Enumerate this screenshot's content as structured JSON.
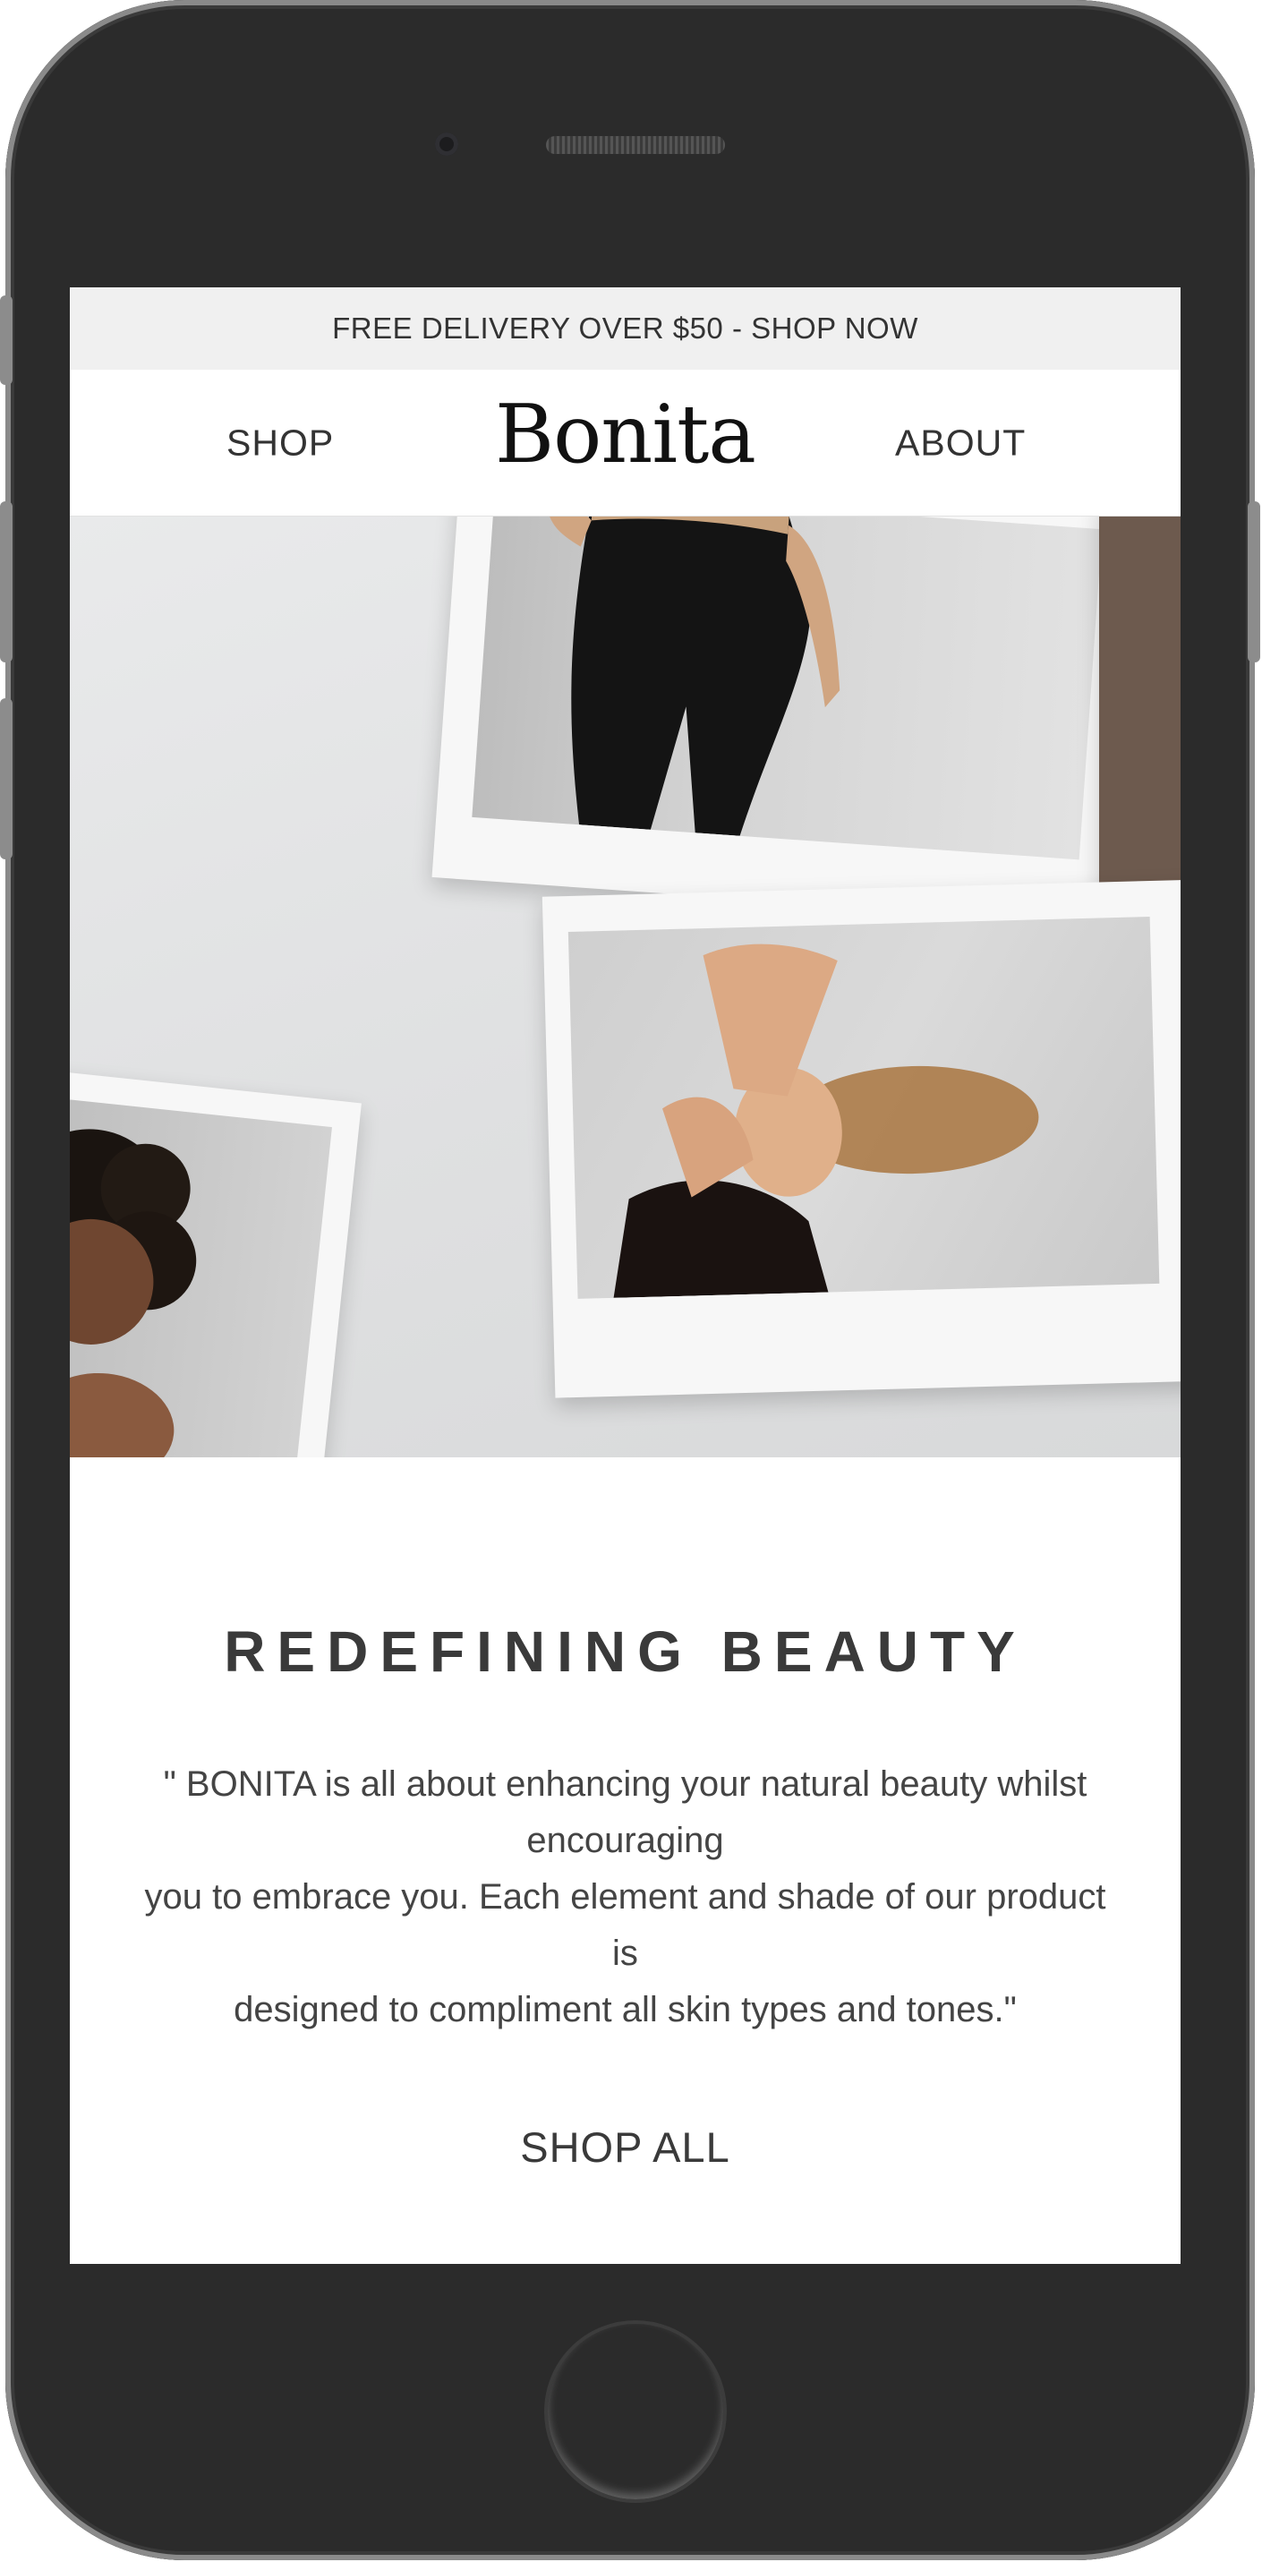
{
  "promo": {
    "text": "FREE DELIVERY OVER $50 - SHOP NOW"
  },
  "nav": {
    "shop_label": "SHOP",
    "brand": "Bonita",
    "about_label": "ABOUT"
  },
  "hero": {
    "image_description_icons": [
      "photo-tights-back",
      "photo-woman-lying",
      "photo-curly-hair"
    ]
  },
  "main": {
    "headline": "REDEFINING BEAUTY",
    "quote_line1": "\" BONITA is all about enhancing your natural beauty whilst encouraging",
    "quote_line2": "you to embrace you. Each element and shade of our product is",
    "quote_line3": "designed to compliment all skin types and tones.\"",
    "cta_label": "SHOP ALL"
  },
  "colors": {
    "phone_body": "#2b2b2b",
    "promo_bg": "#f0f0f0",
    "text_dark": "#333333"
  }
}
